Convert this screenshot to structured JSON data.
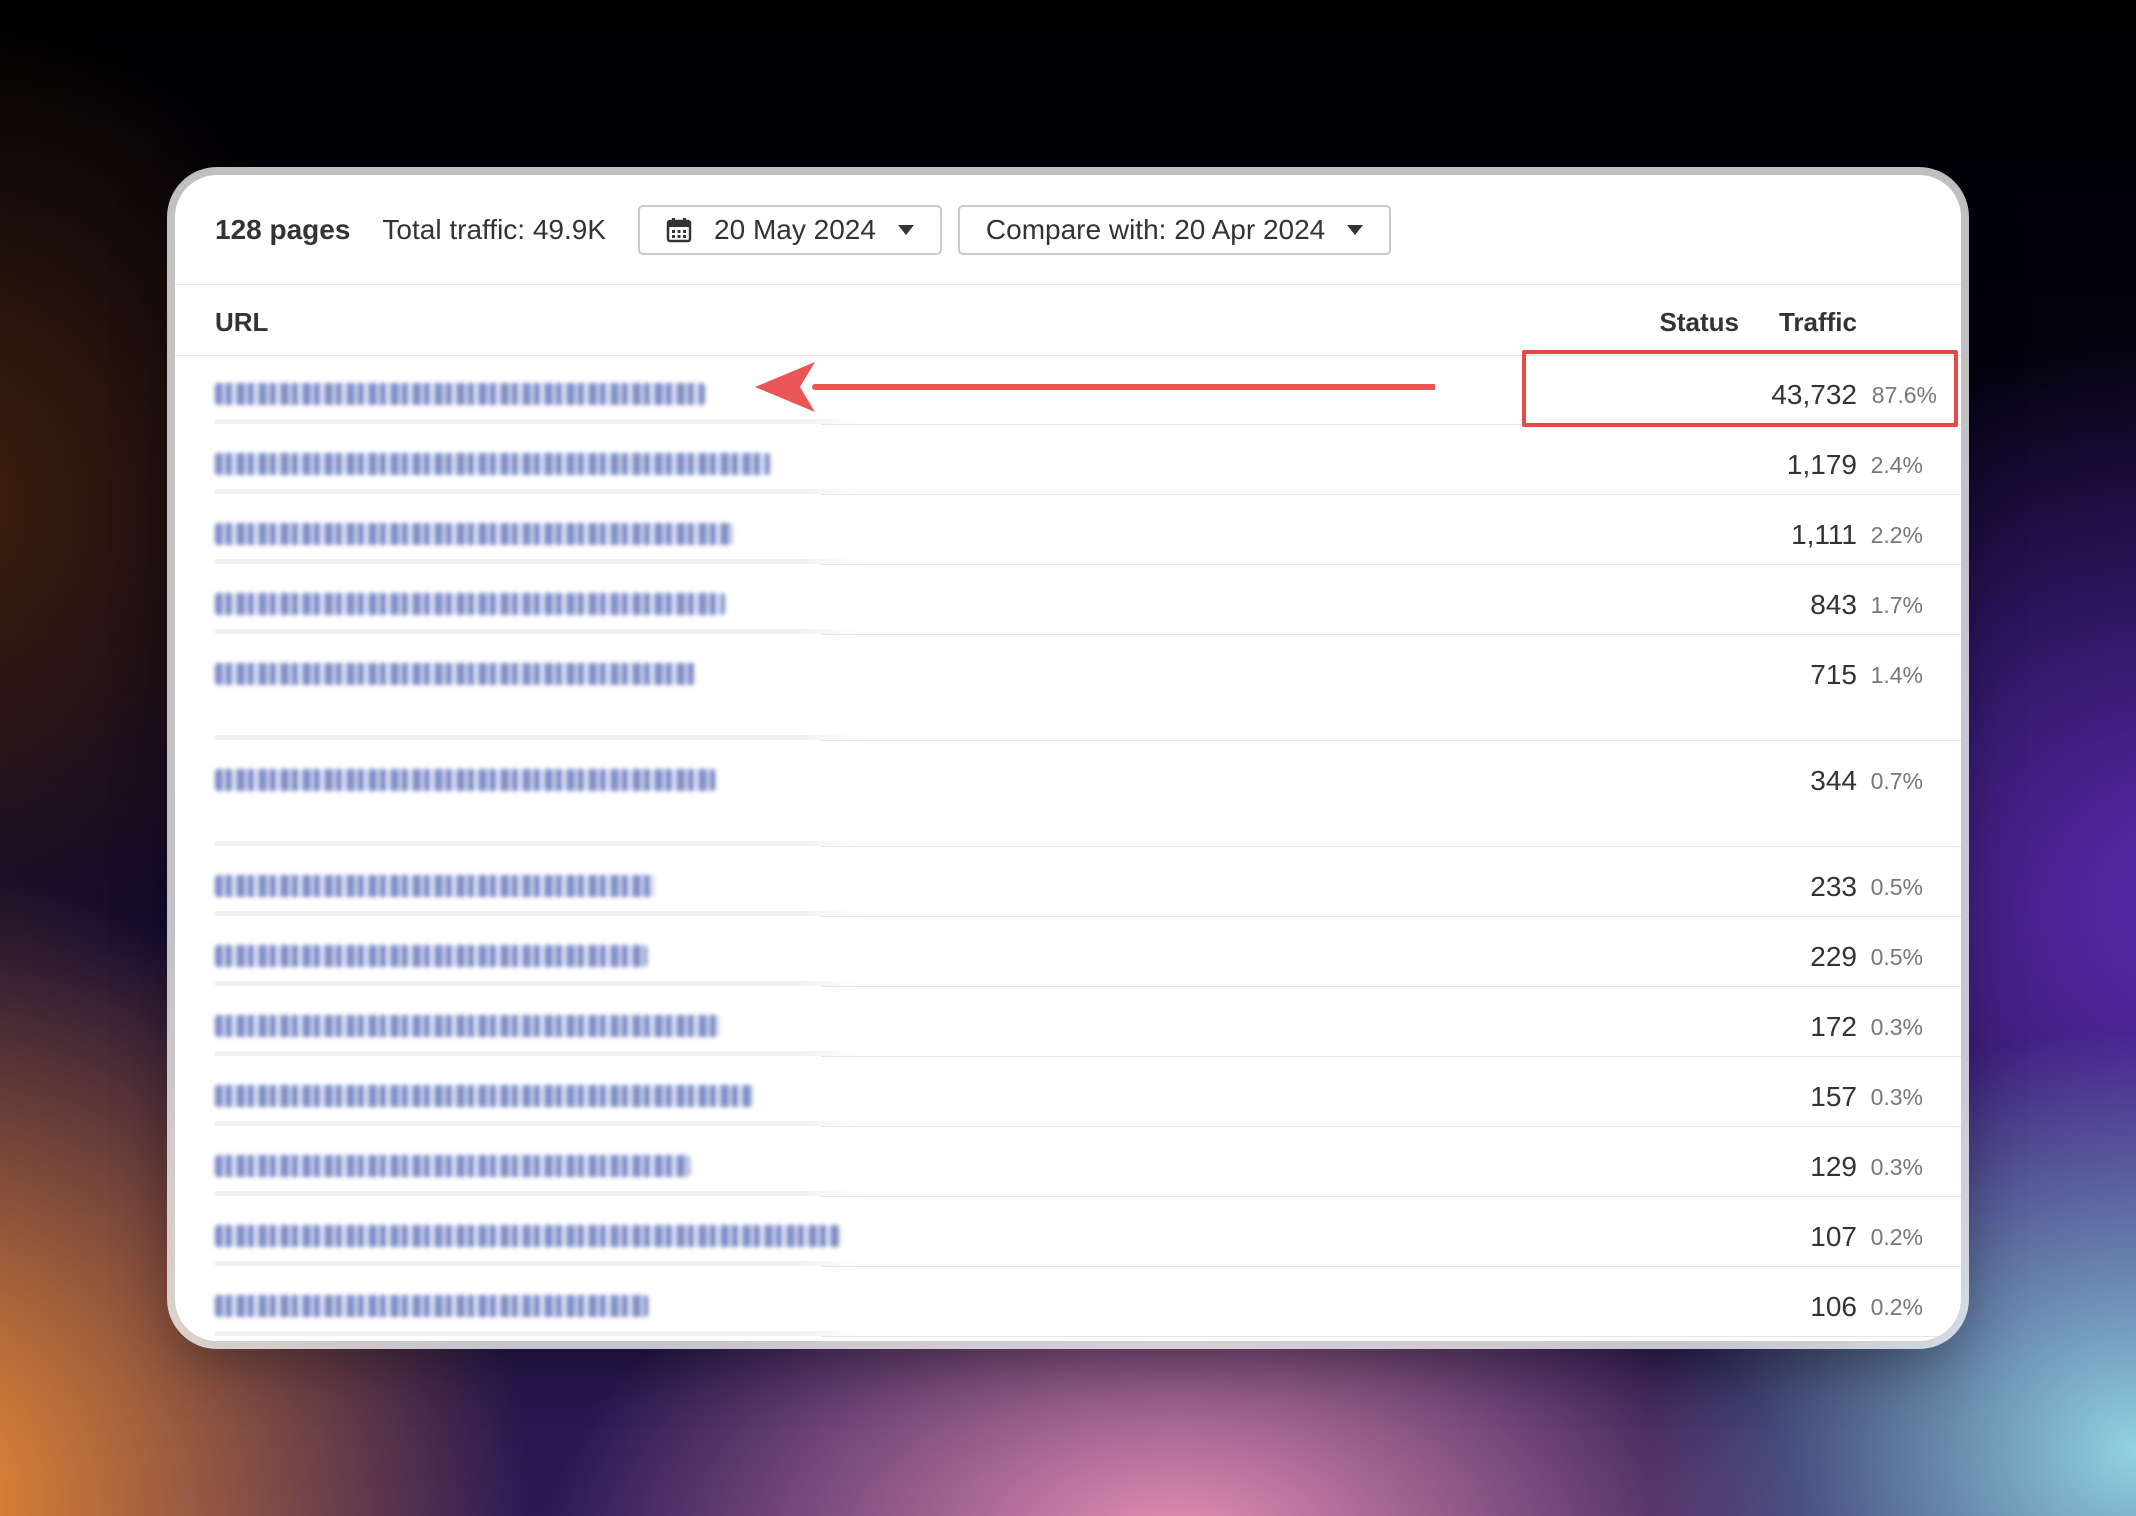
{
  "toolbar": {
    "pages": "128 pages",
    "total_traffic": "Total traffic: 49.9K",
    "date": "20 May 2024",
    "compare": "Compare with: 20 Apr 2024",
    "icons": [
      "calendar-icon",
      "caret-down-icon"
    ]
  },
  "table": {
    "columns": [
      "URL",
      "Status",
      "Traffic"
    ],
    "rows": [
      {
        "traffic": "43,732",
        "pct": "87.6%"
      },
      {
        "traffic": "1,179",
        "pct": "2.4%"
      },
      {
        "traffic": "1,111",
        "pct": "2.2%"
      },
      {
        "traffic": "843",
        "pct": "1.7%"
      },
      {
        "traffic": "715",
        "pct": "1.4%"
      },
      {
        "traffic": "344",
        "pct": "0.7%"
      },
      {
        "traffic": "233",
        "pct": "0.5%"
      },
      {
        "traffic": "229",
        "pct": "0.5%"
      },
      {
        "traffic": "172",
        "pct": "0.3%"
      },
      {
        "traffic": "157",
        "pct": "0.3%"
      },
      {
        "traffic": "129",
        "pct": "0.3%"
      },
      {
        "traffic": "107",
        "pct": "0.2%"
      },
      {
        "traffic": "106",
        "pct": "0.2%"
      }
    ]
  },
  "annotation": {
    "highlight_color": "#e34b4b",
    "arrow_color": "#e85656"
  }
}
